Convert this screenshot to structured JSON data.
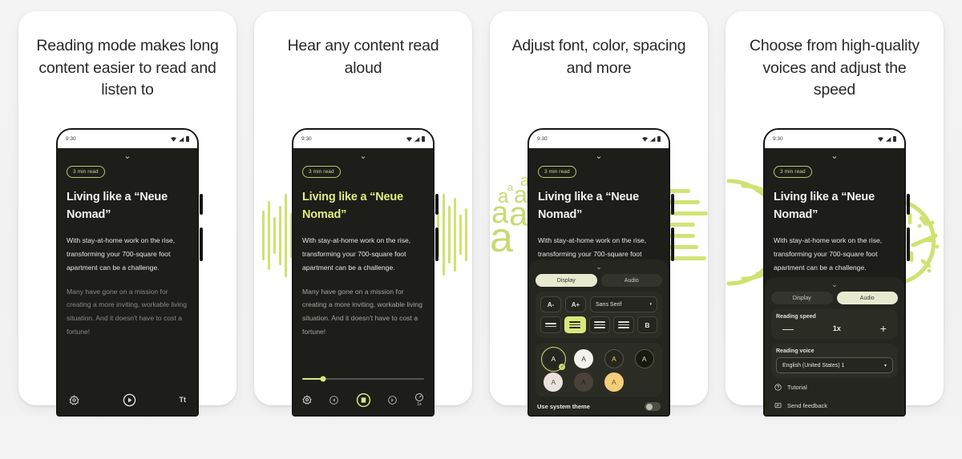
{
  "app": {
    "background_color": "#f2f2f2",
    "accent_green": "#cfe271",
    "screen_dark": "#1d1e1a"
  },
  "phone": {
    "status_time": "9:30",
    "status_icons": [
      "wifi-icon",
      "signal-icon",
      "battery-icon"
    ],
    "chevron": "⌄"
  },
  "article": {
    "badge": "3 min read",
    "title": "Living like a “Neue Nomad”",
    "paragraph1": "With stay-at-home work on the rise, transforming your 700-square foot apartment can be a challenge.",
    "paragraph2": "Many have gone on a mission for creating a more inviting, workable living situation. And it doesn't have to cost a fortune!"
  },
  "panels": [
    {
      "id": "panel-reading-mode",
      "headline": "Reading mode makes long content easier to read and listen to",
      "decoration": "none",
      "title_spoken": false,
      "toolbar": {
        "type": "reader",
        "items": [
          {
            "name": "settings-icon",
            "label": "Settings"
          },
          {
            "name": "play-icon",
            "label": "Play"
          },
          {
            "name": "text-format-icon",
            "label": "Tt"
          }
        ]
      }
    },
    {
      "id": "panel-read-aloud",
      "headline": "Hear any content read aloud",
      "decoration": "waveform",
      "title_spoken": true,
      "toolbar": {
        "type": "audio-player",
        "progress_percent": 17,
        "items": [
          {
            "name": "settings-icon",
            "label": "Settings"
          },
          {
            "name": "rewind-icon",
            "label": "Previous"
          },
          {
            "name": "pause-icon",
            "label": "Pause"
          },
          {
            "name": "forward-icon",
            "label": "Next"
          },
          {
            "name": "speed-icon",
            "label": "1x"
          }
        ]
      }
    },
    {
      "id": "panel-display-settings",
      "headline": "Adjust font, color, spacing and more",
      "decoration": "letters-and-lines",
      "title_spoken": false,
      "sheet": "display"
    },
    {
      "id": "panel-voice-settings",
      "headline": "Choose from high-quality voices and adjust the speed",
      "decoration": "arcs-and-dial",
      "title_spoken": false,
      "sheet": "audio"
    }
  ],
  "display_sheet": {
    "tabs": [
      {
        "label": "Display",
        "active": true
      },
      {
        "label": "Audio",
        "active": false
      }
    ],
    "font_decrease": "A-",
    "font_increase": "A+",
    "font_family_value": "Sans Serif",
    "font_family_caret": "▾",
    "alignment_options": [
      {
        "name": "line-spacing-compact",
        "lines": 2,
        "active": false
      },
      {
        "name": "line-spacing-normal",
        "lines": 3,
        "active": true
      },
      {
        "name": "line-spacing-loose",
        "lines": 3,
        "active": false
      },
      {
        "name": "line-spacing-wide",
        "lines": 3,
        "active": false
      }
    ],
    "bold_label": "B",
    "themes": [
      {
        "name": "theme-dark",
        "bg": "#24261f",
        "letter": "A",
        "letter_color": "#f1f1ea",
        "selected": true
      },
      {
        "name": "theme-white",
        "bg": "#f3f2ee",
        "letter": "A",
        "letter_color": "#3a3a34",
        "selected": false
      },
      {
        "name": "theme-dark-yellow",
        "bg": "#24261f",
        "letter": "A",
        "letter_color": "#f0d95a",
        "selected": false
      },
      {
        "name": "theme-black",
        "bg": "#18190f",
        "letter": "A",
        "letter_color": "#d8d8d0",
        "selected": false
      },
      {
        "name": "theme-blush",
        "bg": "#ebe2de",
        "letter": "A",
        "letter_color": "#5a524e",
        "selected": false
      },
      {
        "name": "theme-brown",
        "bg": "#4a4138",
        "letter": "A",
        "letter_color": "#2a241d",
        "selected": false
      },
      {
        "name": "theme-amber",
        "bg": "#f4ce79",
        "letter": "A",
        "letter_color": "#6b5526",
        "selected": false
      }
    ],
    "system_theme_label": "Use system theme",
    "system_theme_on": false
  },
  "audio_sheet": {
    "tabs": [
      {
        "label": "Display",
        "active": false
      },
      {
        "label": "Audio",
        "active": true
      }
    ],
    "reading_speed_label": "Reading speed",
    "speed_decrease": "—",
    "speed_value": "1x",
    "speed_increase": "+",
    "reading_voice_label": "Reading voice",
    "voice_value": "English (United States) 1",
    "voice_caret": "▾",
    "menu": [
      {
        "icon": "help-circle-icon",
        "label": "Tutorial"
      },
      {
        "icon": "feedback-icon",
        "label": "Send feedback"
      }
    ]
  }
}
